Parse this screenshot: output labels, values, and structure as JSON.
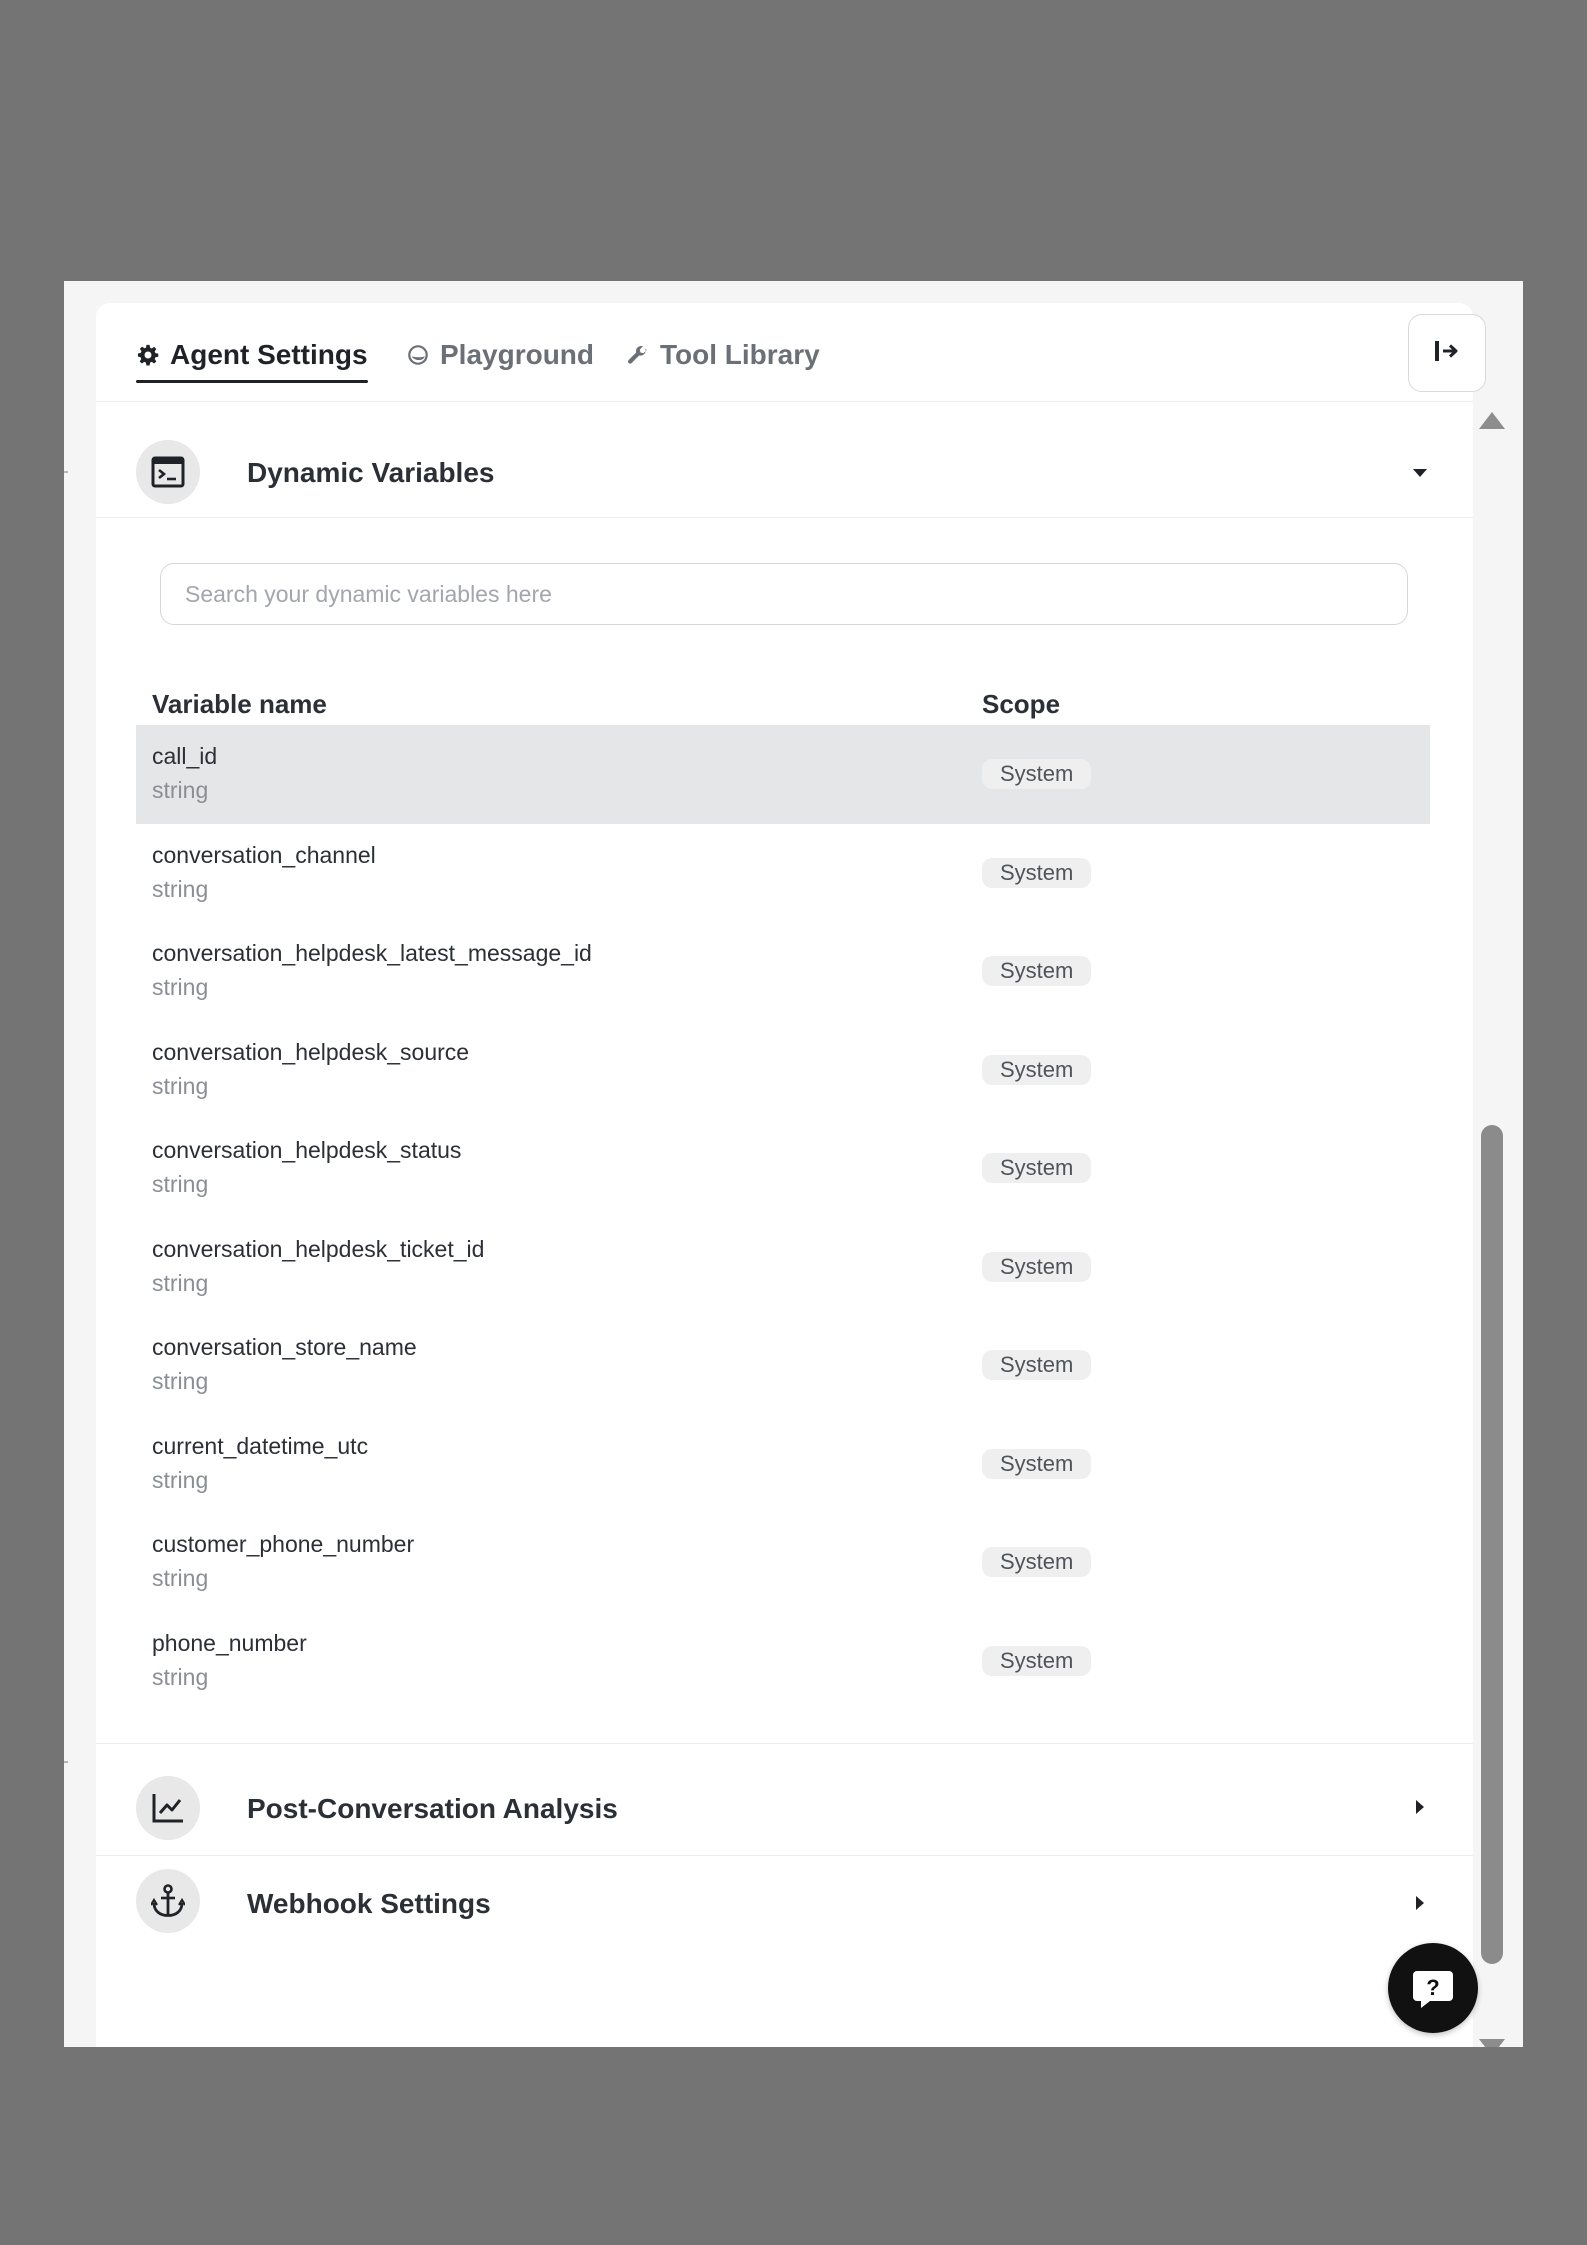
{
  "tabs": [
    {
      "label": "Agent Settings",
      "icon": "gear-icon",
      "active": true
    },
    {
      "label": "Playground",
      "icon": "globe-icon",
      "active": false
    },
    {
      "label": "Tool Library",
      "icon": "wrench-icon",
      "active": false
    }
  ],
  "header": {
    "collapse_icon": "collapse-right-icon"
  },
  "sections": {
    "dynamic_variables": {
      "title": "Dynamic Variables",
      "icon": "terminal-icon",
      "expanded": true
    },
    "post_conversation": {
      "title": "Post-Conversation Analysis",
      "icon": "chart-line-icon",
      "expanded": false
    },
    "webhook": {
      "title": "Webhook Settings",
      "icon": "anchor-icon",
      "expanded": false
    }
  },
  "search": {
    "placeholder": "Search your dynamic variables here",
    "value": ""
  },
  "table": {
    "headers": {
      "name": "Variable name",
      "scope": "Scope"
    },
    "rows": [
      {
        "name": "call_id",
        "type": "string",
        "scope": "System"
      },
      {
        "name": "conversation_channel",
        "type": "string",
        "scope": "System"
      },
      {
        "name": "conversation_helpdesk_latest_message_id",
        "type": "string",
        "scope": "System"
      },
      {
        "name": "conversation_helpdesk_source",
        "type": "string",
        "scope": "System"
      },
      {
        "name": "conversation_helpdesk_status",
        "type": "string",
        "scope": "System"
      },
      {
        "name": "conversation_helpdesk_ticket_id",
        "type": "string",
        "scope": "System"
      },
      {
        "name": "conversation_store_name",
        "type": "string",
        "scope": "System"
      },
      {
        "name": "current_datetime_utc",
        "type": "string",
        "scope": "System"
      },
      {
        "name": "customer_phone_number",
        "type": "string",
        "scope": "System"
      },
      {
        "name": "phone_number",
        "type": "string",
        "scope": "System"
      }
    ]
  },
  "help": {
    "icon": "help-icon",
    "glyph": "?"
  },
  "colors": {
    "background": "#747474",
    "panel": "#ffffff",
    "selected_row": "#e5e6e7",
    "help_button": "#111111"
  }
}
